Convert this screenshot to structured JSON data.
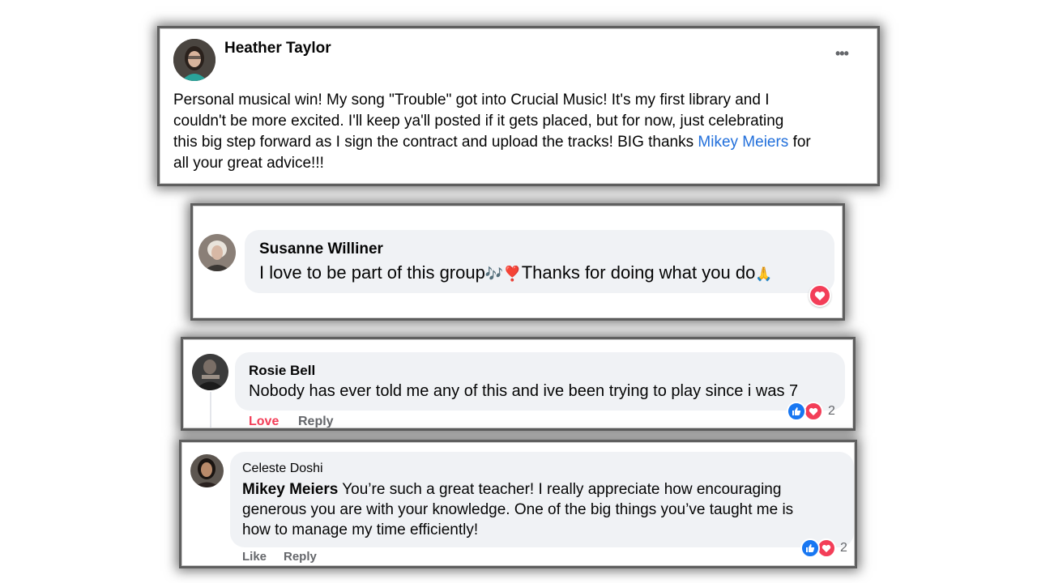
{
  "post": {
    "author": "Heather Taylor",
    "more_label": "•••",
    "lines": [
      "Personal musical win! My song \"Trouble\" got into Crucial Music!  It's my first library and I",
      "couldn't be more excited. I'll keep ya'll posted if it gets placed, but for now, just celebrating",
      "this big step forward as I sign the contract and upload the tracks! BIG thanks "
    ],
    "mention": "Mikey Meiers",
    "line3_after": " for",
    "line4": "all your great advice!!!"
  },
  "comments": [
    {
      "author": "Susanne Williner",
      "text_a": "I love to be part of this group",
      "emoji_a": "🎶",
      "emoji_b": "❣️",
      "text_b": "Thanks for doing what you do",
      "emoji_c": "🙏",
      "reaction": "love"
    },
    {
      "author": "Rosie Bell",
      "text": "Nobody has ever told me any of this and ive been trying to play since i was 7",
      "love_label": "Love",
      "reply_label": "Reply",
      "reaction_count": "2"
    },
    {
      "author": "Celeste Doshi",
      "mention": "Mikey Meiers",
      "lines": [
        " You’re such a great teacher! I really appreciate how encouraging",
        "generous you are with your knowledge. One of the big things you’ve taught me is",
        "how to manage my time efficiently!"
      ],
      "like_label": "Like",
      "reply_label": "Reply",
      "reaction_count": "2"
    }
  ],
  "colors": {
    "mention": "#216fdb",
    "love": "#f33e58",
    "like": "#1877f2",
    "bubble": "#f0f2f5",
    "muted": "#65676b"
  }
}
